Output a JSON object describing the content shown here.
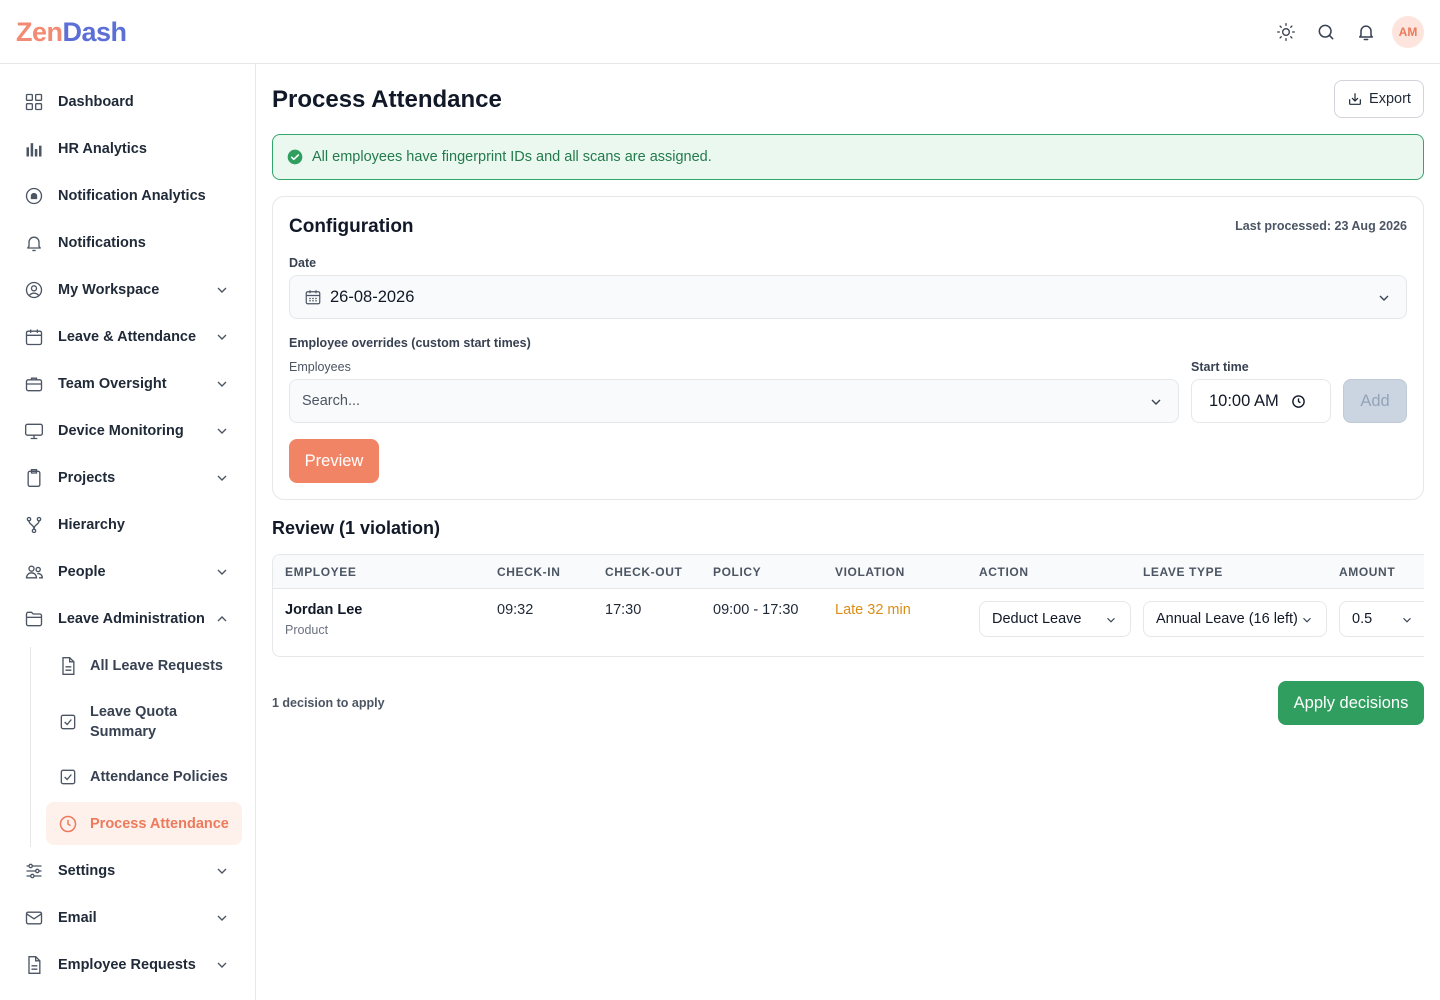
{
  "app": {
    "logo_part1": "Zen",
    "logo_part2": "Dash",
    "avatar_initials": "AM"
  },
  "sidebar": {
    "items": [
      {
        "label": "Dashboard",
        "icon": "grid-icon"
      },
      {
        "label": "HR Analytics",
        "icon": "bar-chart-icon"
      },
      {
        "label": "Notification Analytics",
        "icon": "notification-analytics-icon"
      },
      {
        "label": "Notifications",
        "icon": "bell-icon"
      },
      {
        "label": "My Workspace",
        "icon": "user-circle-icon"
      },
      {
        "label": "Leave & Attendance",
        "icon": "calendar-icon"
      },
      {
        "label": "Team Oversight",
        "icon": "briefcase-icon"
      },
      {
        "label": "Device Monitoring",
        "icon": "monitor-icon"
      },
      {
        "label": "Projects",
        "icon": "clipboard-icon"
      },
      {
        "label": "Hierarchy",
        "icon": "hierarchy-icon"
      },
      {
        "label": "People",
        "icon": "users-icon"
      },
      {
        "label": "Leave Administration",
        "icon": "folder-icon"
      },
      {
        "label": "Settings",
        "icon": "sliders-icon"
      },
      {
        "label": "Email",
        "icon": "mail-icon"
      },
      {
        "label": "Employee Requests",
        "icon": "document-icon"
      }
    ],
    "sub_items": [
      {
        "label": "All Leave Requests",
        "icon": "document-icon"
      },
      {
        "label": "Leave Quota Summary",
        "icon": "check-square-icon"
      },
      {
        "label": "Attendance Policies",
        "icon": "check-square-icon"
      },
      {
        "label": "Process Attendance",
        "icon": "clock-icon"
      }
    ]
  },
  "main": {
    "title": "Process Attendance",
    "export_label": "Export",
    "alert_text": "All employees have fingerprint IDs and all scans are assigned.",
    "config": {
      "title": "Configuration",
      "last_processed": "Last processed: 23 Aug 2026",
      "date_label": "Date",
      "date_value": "26-08-2026",
      "overrides_label": "Employee overrides (custom start times)",
      "employees_label": "Employees",
      "employees_placeholder": "Search...",
      "start_time_label": "Start time",
      "start_time_value": "10:00 AM",
      "add_label": "Add",
      "preview_label": "Preview"
    },
    "review": {
      "title": "Review (1 violation)",
      "columns": [
        "EMPLOYEE",
        "CHECK-IN",
        "CHECK-OUT",
        "POLICY",
        "VIOLATION",
        "ACTION",
        "LEAVE TYPE",
        "AMOUNT"
      ],
      "rows": [
        {
          "employee": "Jordan Lee",
          "department": "Product",
          "check_in": "09:32",
          "check_out": "17:30",
          "policy": "09:00 - 17:30",
          "violation": "Late 32 min",
          "action": "Deduct Leave",
          "leave_type": "Annual Leave (16 left)",
          "amount": "0.5"
        }
      ]
    },
    "decisions_note": "1 decision to apply",
    "apply_label": "Apply decisions"
  },
  "colors": {
    "accent": "#f28466",
    "success": "#2f9e5f",
    "warning": "#dc8d16"
  }
}
